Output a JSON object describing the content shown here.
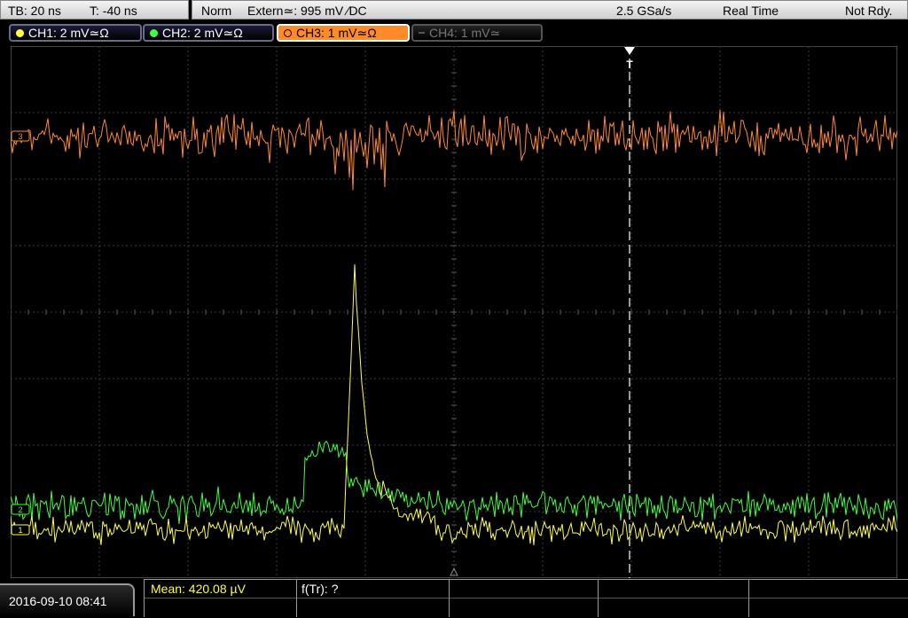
{
  "top": {
    "timebase": "TB: 20 ns",
    "trigger_time": "T: -40 ns",
    "mode": "Norm",
    "trigger_source": "Extern≃: 995 mV ∕DC",
    "sample_rate": "2.5 GSa/s",
    "acq_mode": "Real Time",
    "status": "Not Rdy."
  },
  "channels": [
    {
      "label": "CH1: 2 mV≃Ω",
      "color": "#ffff40",
      "state": "on"
    },
    {
      "label": "CH2: 2 mV≃Ω",
      "color": "#40ff40",
      "state": "on"
    },
    {
      "label": "CH3: 1 mV≃Ω",
      "color": "#ff8a2a",
      "state": "selected"
    },
    {
      "label": "CH4: 1 mV≃",
      "color": "#666666",
      "state": "off"
    }
  ],
  "markers": {
    "trigger": "T",
    "ch3": "3",
    "ch2": "2",
    "ch1": "1"
  },
  "bottom": {
    "datetime": "2016-09-10 08:41",
    "meas1": "Mean: 420.08 µV",
    "meas2": "f(Tr): ?"
  },
  "colors": {
    "ch1": "#ffff40",
    "ch2": "#40ff40",
    "ch3": "#ff8a2a",
    "grid": "#3a3a3a"
  }
}
